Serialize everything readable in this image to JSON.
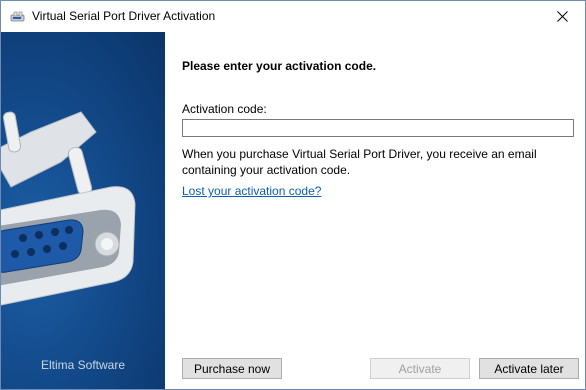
{
  "window": {
    "title": "Virtual Serial Port Driver Activation",
    "close_icon": "close-icon"
  },
  "sidebar": {
    "vendor": "Eltima Software",
    "art": "serial-connector-illustration"
  },
  "main": {
    "heading": "Please enter your activation code.",
    "field_label": "Activation code:",
    "code_value": "",
    "info": "When you purchase Virtual Serial Port Driver, you receive an email containing your activation code.",
    "lost_link": "Lost your activation code?"
  },
  "buttons": {
    "purchase": "Purchase now",
    "activate": "Activate",
    "later": "Activate later"
  },
  "colors": {
    "sidebar": "#134a8a",
    "link": "#0b5fb0"
  }
}
